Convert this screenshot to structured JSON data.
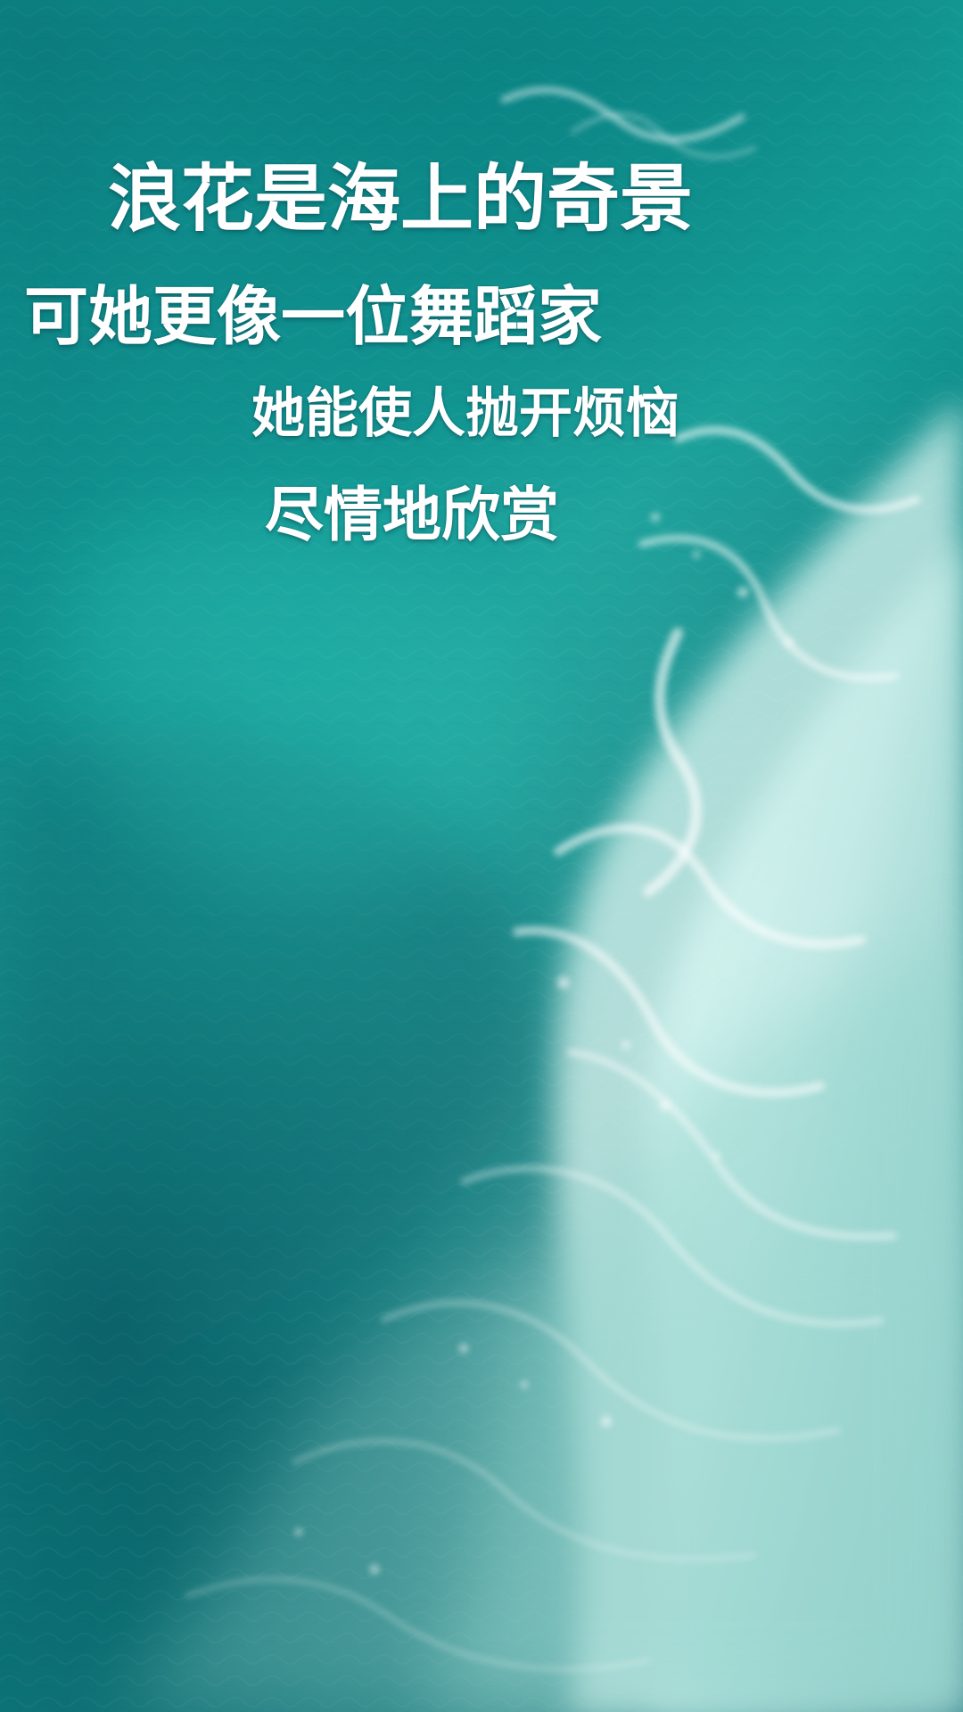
{
  "poster": {
    "lines": [
      "浪花是海上的奇景",
      "可她更像一位舞蹈家",
      "她能使人抛开烦恼",
      "尽情地欣赏"
    ]
  }
}
